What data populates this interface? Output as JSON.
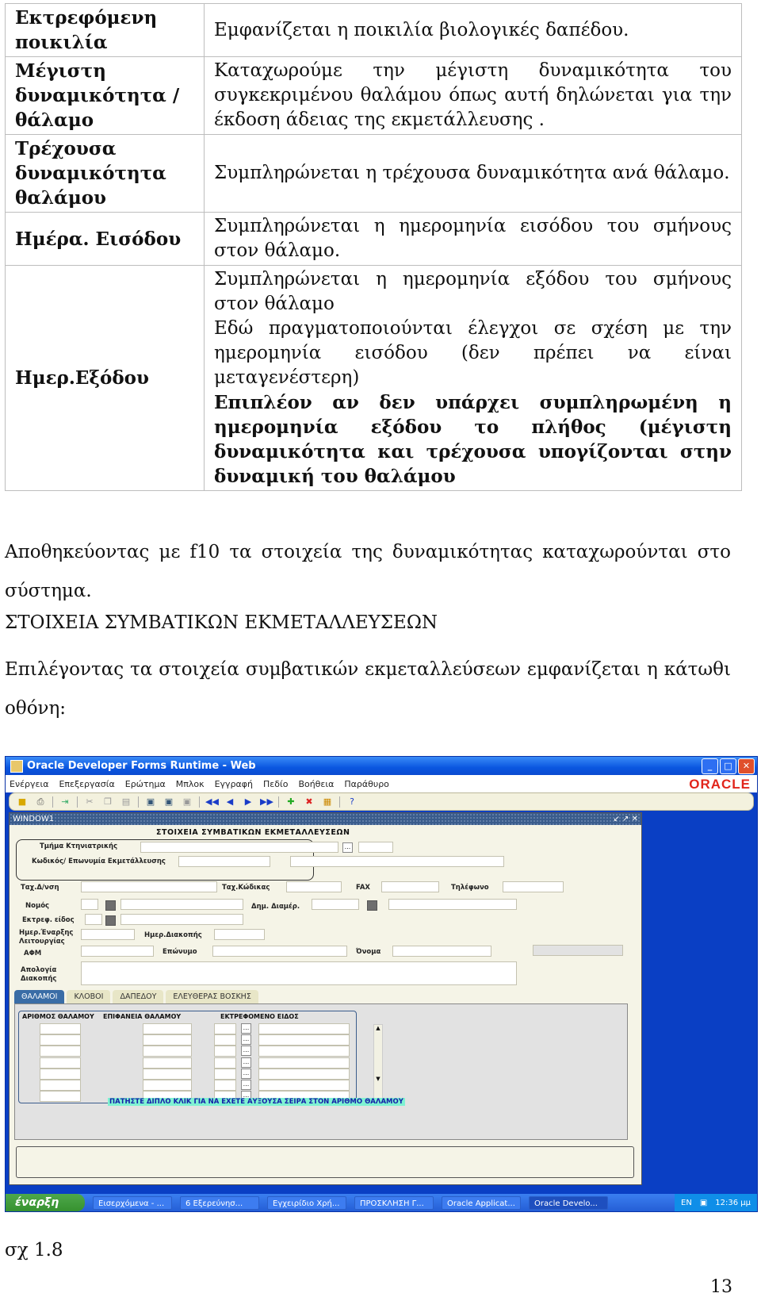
{
  "table": {
    "rows": [
      {
        "term": "Εκτρεφόμενη ποικιλία",
        "desc": [
          "Εμφανίζεται η ποικιλία βιολογικές δαπέδου."
        ],
        "desc_bold": []
      },
      {
        "term": "Μέγιστη δυναμικότητα /θάλαμο",
        "desc": [
          "Καταχωρούμε την μέγιστη δυναμικότητα του συγκεκριμένου θαλάμου όπως αυτή δηλώνεται για την έκδοση άδειας της εκμετάλλευσης ."
        ],
        "desc_bold": []
      },
      {
        "term": "Τρέχουσα δυναμικότητα θαλάμου",
        "desc": [
          "Συμπληρώνεται η τρέχουσα δυναμικότητα ανά θάλαμο."
        ],
        "desc_bold": []
      },
      {
        "term": "Ημέρα. Εισόδου",
        "desc": [
          "Συμπληρώνεται η ημερομηνία εισόδου του σμήνους στον θάλαμο."
        ],
        "desc_bold": []
      },
      {
        "term": "Ημερ.Εξόδου",
        "desc": [
          "Συμπληρώνεται η ημερομηνία εξόδου του σμήνους στον θάλαμο",
          "Εδώ πραγματοποιούνται έλεγχοι σε σχέση με την ημερομηνία εισόδου (δεν πρέπει να είναι μεταγενέστερη)"
        ],
        "desc_bold": [
          "Επιπλέον αν δεν υπάρχει συμπληρωμένη η ημερομηνία εξόδου το πλήθος (μέγιστη δυναμικότητα και τρέχουσα υπογίζονται στην δυναμική του θαλάμου"
        ]
      }
    ]
  },
  "paragraph1": "Αποθηκεύοντας με f10 τα στοιχεία της δυναμικότητας καταχωρούνται στο σύστημα.",
  "heading": "ΣΤΟΙΧΕΙΑ ΣΥΜΒΑΤΙΚΩΝ ΕΚΜΕΤΑΛΛΕΥΣΕΩΝ",
  "paragraph2": "Επιλέγοντας τα στοιχεία συμβατικών εκμεταλλεύσεων εμφανίζεται η κάτωθι οθόνη:",
  "screenshot": {
    "window_title": "Oracle Developer Forms Runtime - Web",
    "menu": [
      "Ενέργεια",
      "Επεξεργασία",
      "Ερώτημα",
      "Μπλοκ",
      "Εγγραφή",
      "Πεδίο",
      "Βοήθεια",
      "Παράθυρο"
    ],
    "brand": "ORACLE",
    "inner_window_title": "WINDOW1",
    "form_title": "ΣΤΟΙΧΕΙΑ ΣΥΜΒΑΤΙΚΩΝ ΕΚΜΕΤΑΛΛΕΥΣΕΩΝ",
    "labels": {
      "dept": "Τμήμα Κτηνιατρικής",
      "code": "Κωδικός/ Επωνυμία Εκμετάλλευσης",
      "address": "Ταχ.Δ/νση",
      "postcode": "Ταχ.Κώδικας",
      "fax": "FAX",
      "phone": "Τηλέφωνο",
      "prefecture": "Νομός",
      "municipality": "Δημ. Διαμέρ.",
      "species": "Εκτρεφ. είδος",
      "start_date": "Ημερ.Έναρξης Λειτουργίας",
      "stop_date": "Ημερ.Διακοπής",
      "afm": "ΑΦΜ",
      "surname": "Επώνυμο",
      "name": "Όνομα",
      "stop_reason": "Απολογία Διακοπής"
    },
    "tabs": [
      "ΘΑΛΑΜΟΙ",
      "ΚΛΟΒΟΙ",
      "ΔΑΠΕΔΟΥ",
      "ΕΛΕΥΘΕΡΑΣ ΒΟΣΚΗΣ"
    ],
    "active_tab": "ΘΑΛΑΜΟΙ",
    "grid_headers": [
      "ΑΡΙΘΜΟΣ ΘΑΛΑΜΟΥ",
      "ΕΠΙΦΑΝΕΙΑ ΘΑΛΑΜΟΥ",
      "ΕΚΤΡΕΦΟΜΕΝΟ ΕΙΔΟΣ"
    ],
    "lov_label": "...",
    "hint": "ΠΑΤΗΣΤΕ ΔΙΠΛΟ ΚΛΙΚ ΓΙΑ ΝΑ ΕΧΕΤΕ ΑΥΞΟΥΣΑ ΣΕΙΡΑ ΣΤΟΝ ΑΡΙΘΜΟ ΘΑΛΑΜΟΥ",
    "taskbar": {
      "start": "έναρξη",
      "tasks": [
        "Εισερχόμενα - ...",
        "6 Εξερεύνησ...",
        "Εγχειρίδιο Χρή...",
        "ΠΡΟΣΚΛΗΣΗ Γ...",
        "Oracle Applicat...",
        "Oracle Develo..."
      ],
      "lang": "EN",
      "clock": "12:36 μμ"
    }
  },
  "caption": "σχ 1.8",
  "page_number": "13"
}
